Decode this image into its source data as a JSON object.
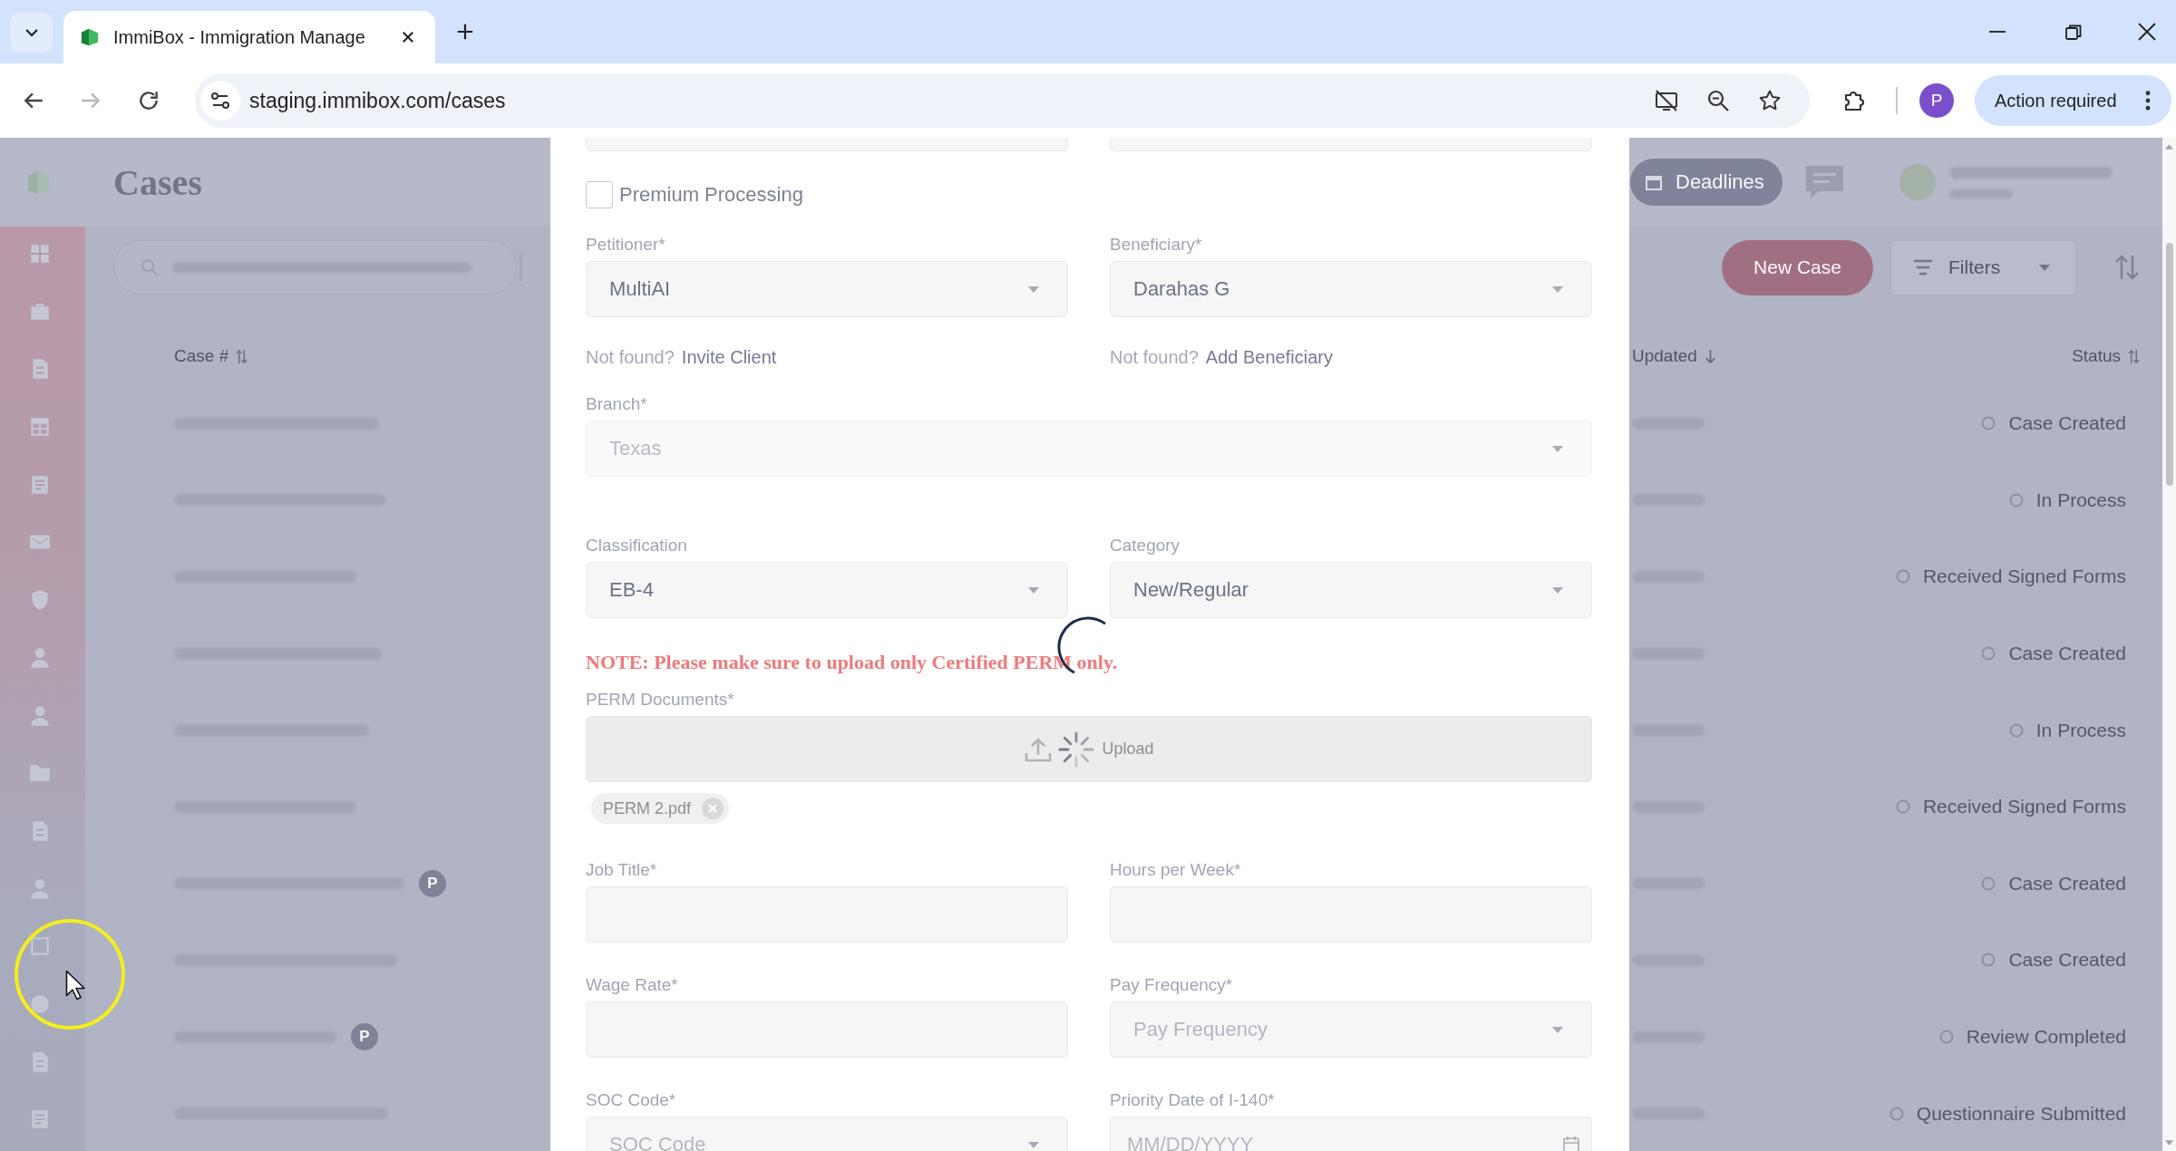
{
  "browser": {
    "tab": {
      "title": "ImmiBox - Immigration Manage",
      "selected": true
    },
    "url": "staging.immibox.com/cases",
    "profile_initial": "P",
    "action_chip": "Action required"
  },
  "app": {
    "title": "Cases",
    "header_button": "Deadlines",
    "new_case_button": "New Case",
    "filters_button": "Filters",
    "columns": [
      {
        "label": "Case #"
      },
      {
        "label": "Updated"
      },
      {
        "label": "Status"
      }
    ],
    "rows": [
      {
        "status": "Case Created"
      },
      {
        "status": "In Process"
      },
      {
        "status": "Received Signed Forms"
      },
      {
        "status": "Case Created"
      },
      {
        "status": "In Process"
      },
      {
        "status": "Received Signed Forms"
      },
      {
        "status": "Case Created",
        "badge": "P"
      },
      {
        "status": "Case Created"
      },
      {
        "status": "Review Completed",
        "badge": "P"
      },
      {
        "status": "Questionnaire Submitted"
      }
    ]
  },
  "modal": {
    "loading": true,
    "premium_processing": {
      "label": "Premium Processing",
      "checked": false
    },
    "rows": [
      [
        {
          "kind": "select",
          "label": "Petitioner*",
          "value": "MultiAI",
          "disabled": false,
          "hint": "Not found?",
          "link": "Invite Client"
        },
        {
          "kind": "select",
          "label": "Beneficiary*",
          "value": "Darahas G",
          "disabled": false,
          "hint": "Not found?",
          "link": "Add Beneficiary"
        }
      ],
      [
        {
          "kind": "select",
          "label": "Branch*",
          "value": "Texas",
          "disabled": true
        }
      ],
      [
        {
          "kind": "select",
          "label": "Classification",
          "value": "EB-4",
          "disabled": false
        },
        {
          "kind": "select",
          "label": "Category",
          "value": "New/Regular",
          "disabled": false
        }
      ]
    ],
    "note": "NOTE: Please make sure to upload only Certified PERM only.",
    "upload": {
      "label": "PERM Documents*",
      "button": "Upload",
      "uploading": true,
      "files": [
        {
          "name": "PERM 2.pdf"
        }
      ]
    },
    "more_rows": [
      [
        {
          "kind": "text",
          "label": "Job Title*"
        },
        {
          "kind": "text",
          "label": "Hours per Week*"
        }
      ],
      [
        {
          "kind": "text",
          "label": "Wage Rate*"
        },
        {
          "kind": "select",
          "label": "Pay Frequency*",
          "placeholder": "Pay Frequency"
        }
      ],
      [
        {
          "kind": "select",
          "label": "SOC Code*",
          "placeholder": "SOC Code"
        },
        {
          "kind": "date",
          "label": "Priority Date of I-140*",
          "placeholder": "MM/DD/YYYY"
        }
      ]
    ]
  }
}
